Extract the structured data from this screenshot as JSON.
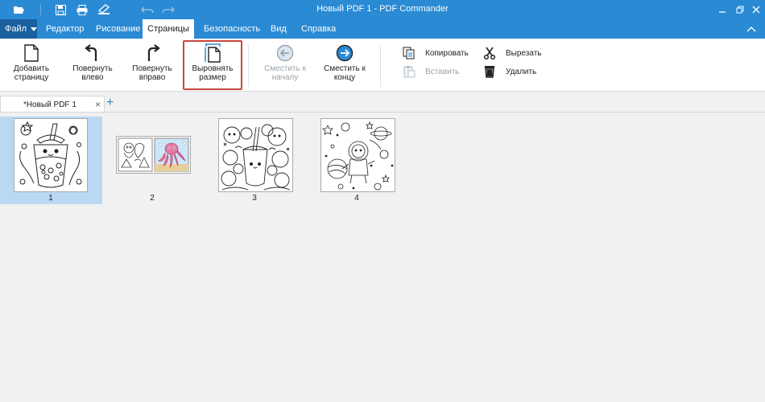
{
  "titlebar": {
    "title": "Новый PDF 1 - PDF Commander"
  },
  "menu": {
    "file": "Файл",
    "tabs": [
      "Редактор",
      "Рисование",
      "Страницы",
      "Безопасность",
      "Вид",
      "Справка"
    ],
    "active_tab": "Страницы"
  },
  "ribbon": {
    "add_page": "Добавить страницу",
    "rotate_left": "Повернуть влево",
    "rotate_right": "Повернуть вправо",
    "align_size": "Выровнять размер",
    "move_start": "Сместить к началу",
    "move_end": "Сместить к концу",
    "copy": "Копировать",
    "paste": "Вставить",
    "cut": "Вырезать",
    "delete": "Удалить"
  },
  "document_tabs": [
    {
      "label": "*Новый PDF 1"
    }
  ],
  "pages": [
    {
      "number": "1",
      "selected": true
    },
    {
      "number": "2",
      "selected": false
    },
    {
      "number": "3",
      "selected": false
    },
    {
      "number": "4",
      "selected": false
    }
  ],
  "colors": {
    "titlebar": "#2a8ad4",
    "file_button": "#1a5f9e",
    "highlight_border": "#c9463d",
    "selection": "#b9d8f3"
  }
}
